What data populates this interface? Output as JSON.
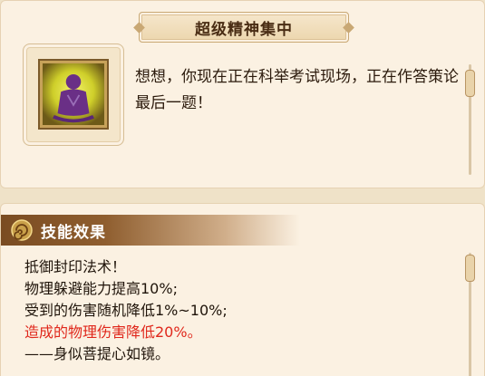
{
  "skill": {
    "title": "超级精神集中",
    "description": "想想，你现在正在科举考试现场，正在作答策论最后一题！",
    "icon": "meditating-figure-icon"
  },
  "effects_section": {
    "header": "技能效果",
    "header_icon": "swirl-icon",
    "lines": [
      {
        "text": "抵御封印法术！",
        "highlight": false
      },
      {
        "text": "物理躲避能力提高10%;",
        "highlight": false
      },
      {
        "text": "受到的伤害随机降低1%~10%;",
        "highlight": false
      },
      {
        "text": "造成的物理伤害降低20%。",
        "highlight": true
      },
      {
        "text": "——身似菩提心如镜。",
        "highlight": false
      }
    ]
  },
  "colors": {
    "highlight": "#e0281c",
    "panel_bg": "#fbf1e2",
    "header_brown": "#7a4c22"
  }
}
